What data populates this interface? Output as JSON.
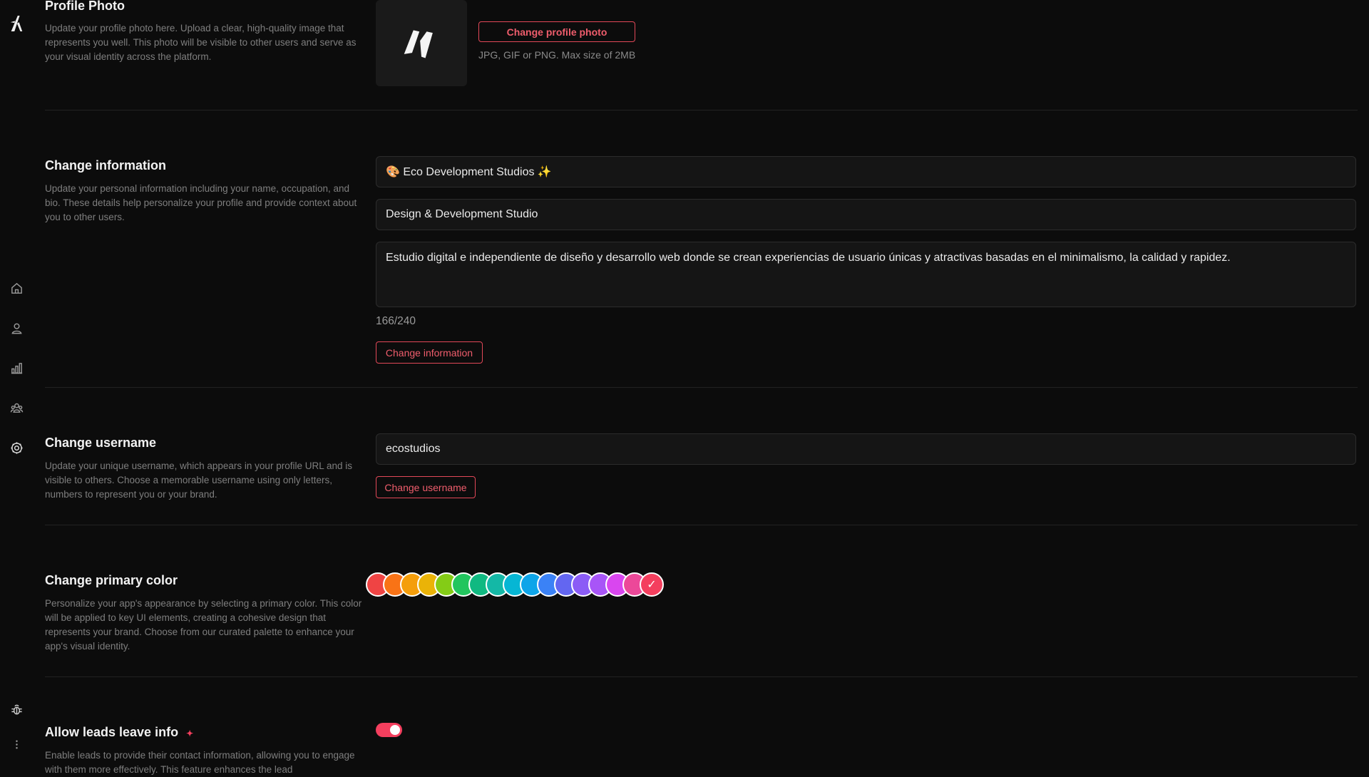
{
  "sidebar": {
    "items": [
      {
        "icon": "logo-icon"
      },
      {
        "icon": "home-icon"
      },
      {
        "icon": "user-icon"
      },
      {
        "icon": "bar-chart-icon"
      },
      {
        "icon": "team-icon"
      },
      {
        "icon": "settings-icon"
      },
      {
        "icon": "bug-icon"
      },
      {
        "icon": "more-vertical-icon"
      }
    ]
  },
  "profile_photo": {
    "title": "Profile Photo",
    "description": "Update your profile photo here. Upload a clear, high-quality image that represents you well. This photo will be visible to other users and serve as your visual identity across the platform.",
    "button_label": "Change profile photo",
    "hint": "JPG, GIF or PNG. Max size of 2MB"
  },
  "change_information": {
    "title": "Change information",
    "description": "Update your personal information including your name, occupation, and bio. These details help personalize your profile and provide context about you to other users.",
    "name_value": "🎨 Eco Development Studios ✨",
    "occupation_value": "Design & Development Studio",
    "bio_value": "Estudio digital e independiente de diseño y desarrollo web donde se crean experiencias de usuario únicas y atractivas basadas en el minimalismo, la calidad y rapidez.",
    "char_count": "166/240",
    "button_label": "Change information"
  },
  "change_username": {
    "title": "Change username",
    "description": "Update your unique username, which appears in your profile URL and is visible to others. Choose a memorable username using only letters, numbers to represent you or your brand.",
    "username_value": "ecostudios",
    "button_label": "Change username"
  },
  "primary_color": {
    "title": "Change primary color",
    "description": "Personalize your app's appearance by selecting a primary color. This color will be applied to key UI elements, creating a cohesive design that represents your brand. Choose from our curated palette to enhance your app's visual identity.",
    "swatches": [
      "#ef4444",
      "#f97316",
      "#f59e0b",
      "#eab308",
      "#84cc16",
      "#22c55e",
      "#10b981",
      "#14b8a6",
      "#06b6d4",
      "#0ea5e9",
      "#3b82f6",
      "#6366f1",
      "#8b5cf6",
      "#a855f7",
      "#d946ef",
      "#ec4899",
      "#f43f5e"
    ],
    "selected_index": 16,
    "check_mark": "✓"
  },
  "allow_leads": {
    "title": "Allow leads leave info",
    "sparkle": "✦",
    "description": "Enable leads to provide their contact information, allowing you to engage with them more effectively. This feature enhances the lead",
    "enabled": true
  },
  "colors": {
    "accent": "#f43f5e",
    "button_border": "#e24858"
  }
}
